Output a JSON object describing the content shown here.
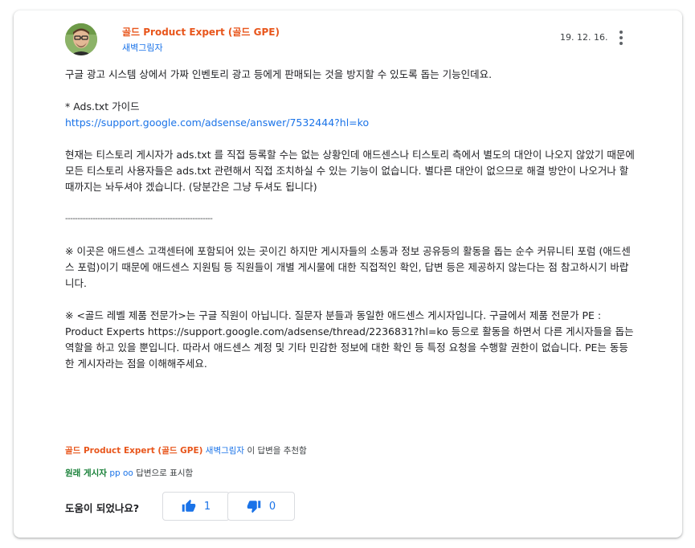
{
  "post": {
    "author": {
      "badge_name": "골드 Product Expert (골드 GPE)",
      "username": "새벽그림자",
      "avatar_icon": "avatar-portrait-icon"
    },
    "date": "19. 12. 16.",
    "more_icon": "more-vert-icon",
    "paragraphs": {
      "p1": "구글 광고 시스템 상에서 가짜 인벤토리 광고 등에게 판매되는 것을 방지할 수 있도록 돕는 기능인데요.",
      "p2_title": "* Ads.txt 가이드",
      "p2_link": "https://support.google.com/adsense/answer/7532444?hl=ko",
      "p3": "현재는 티스토리 게시자가 ads.txt 를 직접 등록할 수는 없는 상황인데 애드센스나 티스토리 측에서 별도의 대안이 나오지 않았기 때문에 모든 티스토리 사용자들은 ads.txt 관련해서 직접 조치하실 수 있는 기능이 없습니다. 별다른 대안이 없으므로 해결 방안이 나오거나 할 때까지는 놔두셔야 겠습니다. (당분간은 그냥 두셔도 됩니다)",
      "divider": "-----------------------------------------------------------",
      "p4": "※ 이곳은 애드센스 고객센터에 포함되어 있는 곳이긴 하지만 게시자들의 소통과 정보 공유등의 활동을 돕는 순수 커뮤니티 포럼 (애드센스 포럼)이기 때문에 애드센스 지원팀 등 직원들이 개별 게시물에 대한 직접적인 확인, 답변 등은 제공하지 않는다는 점 참고하시기 바랍니다.",
      "p5": "※ <골드 레벨 제품 전문가>는 구글 직원이 아닙니다. 질문자 분들과 동일한 애드센스 게시자입니다. 구글에서 제품 전문가 PE : Product Experts  https://support.google.com/adsense/thread/2236831?hl=ko 등으로 활동을 하면서 다른 게시자들을 돕는 역할을 하고 있을 뿐입니다. 따라서 애드센스 계정 및 기타 민감한 정보에 대한 확인 등 특정 요청을 수행할 권한이 없습니다. PE는 동등한 게시자라는 점을 이해해주세요."
    }
  },
  "recommendation": {
    "badge": "골드 Product Expert (골드 GPE)",
    "user": "새벽그림자",
    "suffix": "이 답변을 추천함"
  },
  "original_poster": {
    "label": "원래 게시자",
    "user": "pp oo",
    "suffix": "답변으로 표시함"
  },
  "helpful": {
    "question": "도움이 되었나요?",
    "up_icon": "thumb-up-icon",
    "up_count": "1",
    "down_icon": "thumb-down-icon",
    "down_count": "0"
  },
  "colors": {
    "gpe_orange": "#e8561c",
    "link_blue": "#1a73e8",
    "op_green": "#188038"
  }
}
